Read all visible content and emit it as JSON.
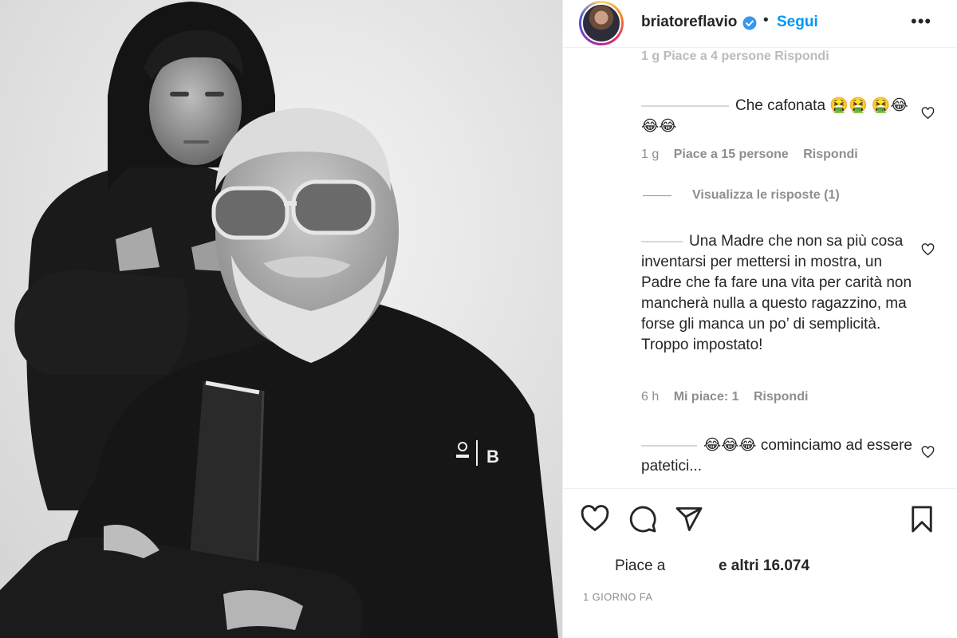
{
  "post": {
    "username": "briatoreflavio",
    "follow_label": "Segui",
    "separator": "•",
    "more_label": "•••"
  },
  "comments": {
    "cut_meta": "1 g   Piace a 4 persone   Rispondi",
    "items": [
      {
        "text": "Che cafonata 🤮🤮 🤮😂😂😂",
        "time": "1 g",
        "likes": "Piace a 15 persone",
        "reply": "Rispondi",
        "view_replies": "Visualizza le risposte (1)"
      },
      {
        "text": "Una Madre che non sa più cosa inventarsi per mettersi in mostra, un Padre che fa fare una vita per carità non mancherà nulla a questo ragazzino, ma forse gli manca un po’ di semplicità. Troppo impostato!",
        "time": "6 h",
        "likes": "Mi piace: 1",
        "reply": "Rispondi"
      },
      {
        "text": "😂😂😂 cominciamo ad essere patetici..."
      }
    ]
  },
  "footer": {
    "likes_prefix": "Piace a",
    "likes_suffix": "e altri 16.074",
    "date": "1 GIORNO FA"
  },
  "photo": {
    "jacket_brand": "B"
  },
  "colors": {
    "link": "#0095f6",
    "text": "#262626",
    "muted": "#8e8e8e",
    "verified": "#3897f0"
  },
  "icons": [
    "verified-icon",
    "heart-icon",
    "comment-icon",
    "share-icon",
    "bookmark-icon",
    "more-icon"
  ]
}
